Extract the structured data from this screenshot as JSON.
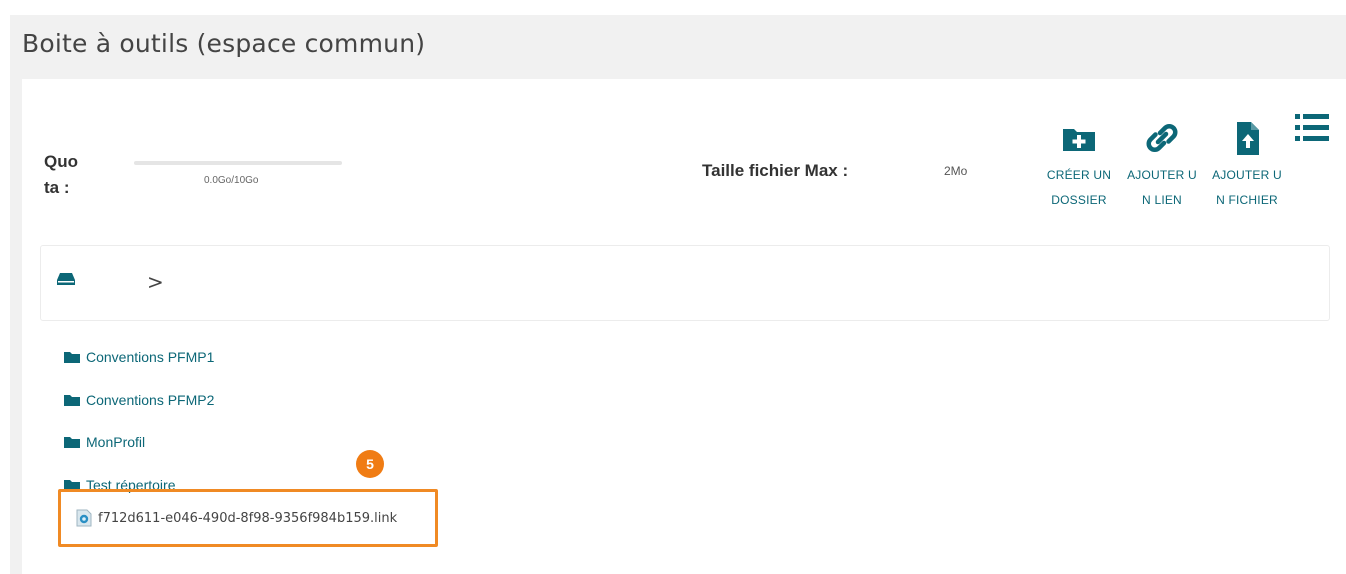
{
  "page": {
    "title": "Boite à outils (espace commun)"
  },
  "quota": {
    "label": "Quo ta :",
    "usage_text": "0.0Go/10Go",
    "fill_fraction": 0.0
  },
  "max_file_size": {
    "label": "Taille fichier Max :",
    "value": "2Mo"
  },
  "actions": [
    {
      "label": "CRÉER UN DOSSIER",
      "icon": "folder-plus-icon"
    },
    {
      "label": "AJOUTER UN LIEN",
      "icon": "link-icon"
    },
    {
      "label": "AJOUTER UN FICHIER",
      "icon": "file-upload-icon"
    }
  ],
  "view_toggle": {
    "icon": "list-view-icon"
  },
  "breadcrumb": {
    "home_icon": "drive-icon",
    "separator": ">"
  },
  "items": [
    {
      "type": "folder",
      "name": "Conventions PFMP1"
    },
    {
      "type": "folder",
      "name": "Conventions PFMP2"
    },
    {
      "type": "folder",
      "name": "MonProfil"
    },
    {
      "type": "folder",
      "name": "Test répertoire"
    },
    {
      "type": "link-file",
      "name": "f712d611-e046-490d-8f98-9356f984b159.link"
    }
  ],
  "annotation": {
    "step_number": "5"
  },
  "colors": {
    "accent": "#0c6777",
    "highlight": "#f08a24",
    "badge": "#f07c14",
    "header_bg": "#f1f1f1"
  }
}
